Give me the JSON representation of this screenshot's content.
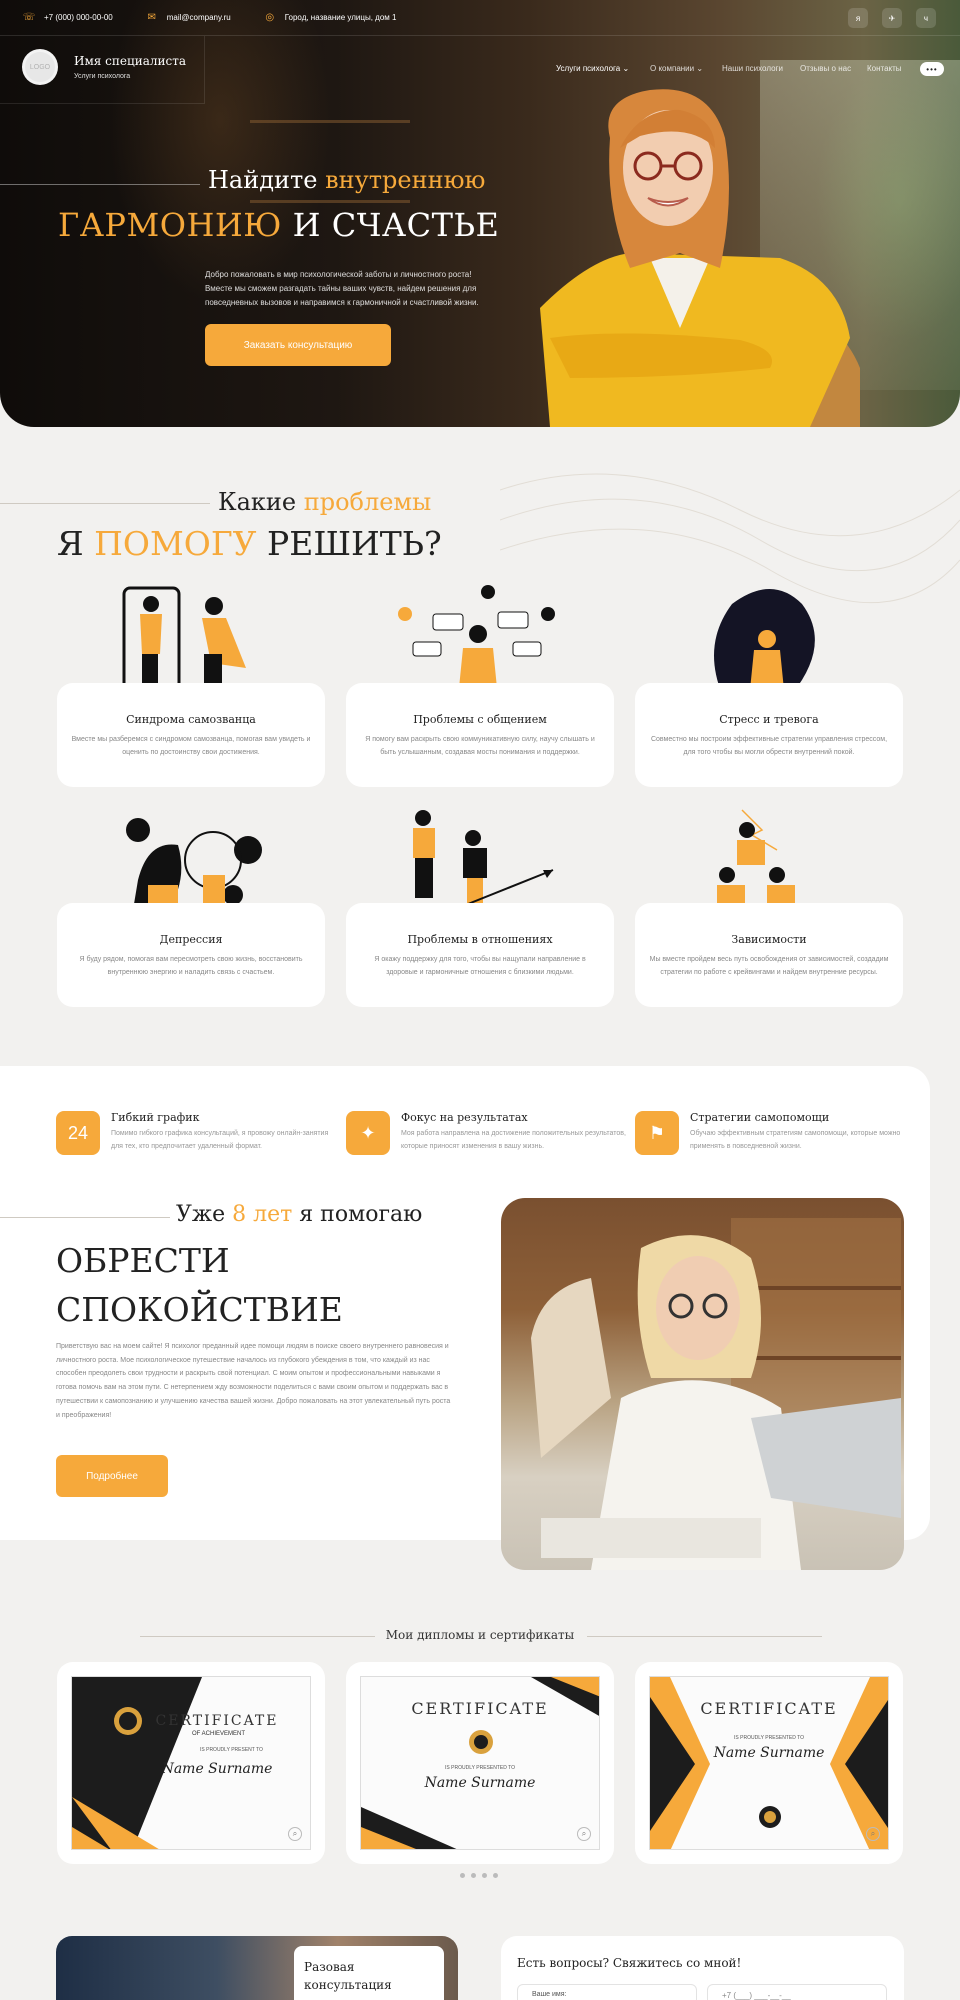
{
  "topbar": {
    "phone": "+7 (000) 000-00-00",
    "email": "mail@company.ru",
    "address": "Город, название улицы, дом 1",
    "socials": [
      "я",
      "✈",
      "ч"
    ]
  },
  "header": {
    "logo": "LOGO",
    "name": "Имя специалиста",
    "subtitle": "Услуги психолога",
    "nav": [
      "Услуги психолога",
      "О компании",
      "Наши психологи",
      "Отзывы о нас",
      "Контакты"
    ],
    "more": "•••"
  },
  "hero": {
    "title1_a": "Найдите ",
    "title1_b": "внутреннюю",
    "title2_a": "ГАРМОНИЮ",
    "title2_b": " И СЧАСТЬЕ",
    "text": "Добро пожаловать в мир психологической заботы и личностного роста! Вместе мы сможем разгадать тайны ваших чувств, найдем решения для повседневных вызовов и направимся к гармоничной и счастливой жизни.",
    "cta": "Заказать консультацию"
  },
  "problems": {
    "title1_a": "Какие ",
    "title1_b": "проблемы",
    "title2_a": "Я ",
    "title2_b": "ПОМОГУ",
    "title2_c": " РЕШИТЬ?",
    "cards": [
      {
        "title": "Синдрома самозванца",
        "text": "Вместе мы разберемся с синдромом самозванца, помогая вам увидеть и оценить по достоинству свои достижения."
      },
      {
        "title": "Проблемы с общением",
        "text": "Я помогу вам раскрыть свою коммуникативную силу, научу слышать и быть услышанным, создавая мосты понимания и поддержки."
      },
      {
        "title": "Стресс и тревога",
        "text": "Совместно мы построим эффективные стратегии управления стрессом, для того чтобы вы могли обрести внутренний покой."
      },
      {
        "title": "Депрессия",
        "text": "Я буду рядом, помогая вам пересмотреть свою жизнь, восстановить внутреннюю энергию и наладить связь с счастьем."
      },
      {
        "title": "Проблемы в отношениях",
        "text": "Я окажу поддержку для того, чтобы вы нащупали направление в здоровые и гармоничные отношения с близкими людьми."
      },
      {
        "title": "Зависимости",
        "text": "Мы вместе пройдем весь путь освобождения от зависимостей, создадим стратегии по работе с крейвингами и найдем внутренние ресурсы."
      }
    ]
  },
  "features": [
    {
      "icon": "24",
      "title": "Гибкий график",
      "text": "Помимо гибкого графика консультаций, я провожу онлайн-занятия для тех, кто предпочитает удаленный формат."
    },
    {
      "icon": "✦",
      "title": "Фокус на результатах",
      "text": "Моя работа направлена на достижение положительных результатов, которые приносят изменения в вашу жизнь."
    },
    {
      "icon": "⚑",
      "title": "Стратегии самопомощи",
      "text": "Обучаю эффективным стратегиям самопомощи, которые можно применять в повседневной жизни."
    }
  ],
  "about": {
    "t1_a": "Уже ",
    "t1_b": "8 лет",
    "t1_c": " я помогаю",
    "t2_a": "ОБРЕСТИ",
    "t2_b": "СПОКОЙСТВИЕ",
    "text": "Приветствую вас на моем сайте! Я психолог преданный идее помощи людям в поиске своего внутреннего равновесия и личностного роста. Мое психологическое путешествие началось из глубокого убеждения в том, что каждый из нас способен преодолеть свои трудности и раскрыть свой потенциал. С моим опытом и профессиональными навыками я готова помочь вам на этом пути. С нетерпением жду возможности поделиться с вами своим опытом и поддержать вас в путешествии к самопознанию и улучшению качества вашей жизни. Добро пожаловать на этот увлекательный путь роста и преображения!",
    "button": "Подробнее"
  },
  "certs": {
    "heading": "Мои дипломы и сертификаты",
    "items": [
      {
        "title": "CERTIFICATE",
        "sub": "OF ACHIEVEMENT",
        "pres": "IS PROUDLY PRESENT TO",
        "name": "Name Surname"
      },
      {
        "title": "CERTIFICATE",
        "sub": "",
        "pres": "IS PROUDLY PRESENTED TO",
        "name": "Name Surname"
      },
      {
        "title": "CERTIFICATE",
        "sub": "",
        "pres": "IS PROUDLY PRESENTED TO",
        "name": "Name Surname"
      }
    ]
  },
  "bottom": {
    "consult": "Разовая консультация",
    "form_title": "Есть вопросы? Свяжитесь со мной!",
    "name_label": "Ваше имя:",
    "phone_placeholder": "+7 (___) ___-__-__"
  },
  "colors": {
    "accent": "#f6a93b",
    "card": "#ffffff",
    "page": "#f2f1ef"
  }
}
